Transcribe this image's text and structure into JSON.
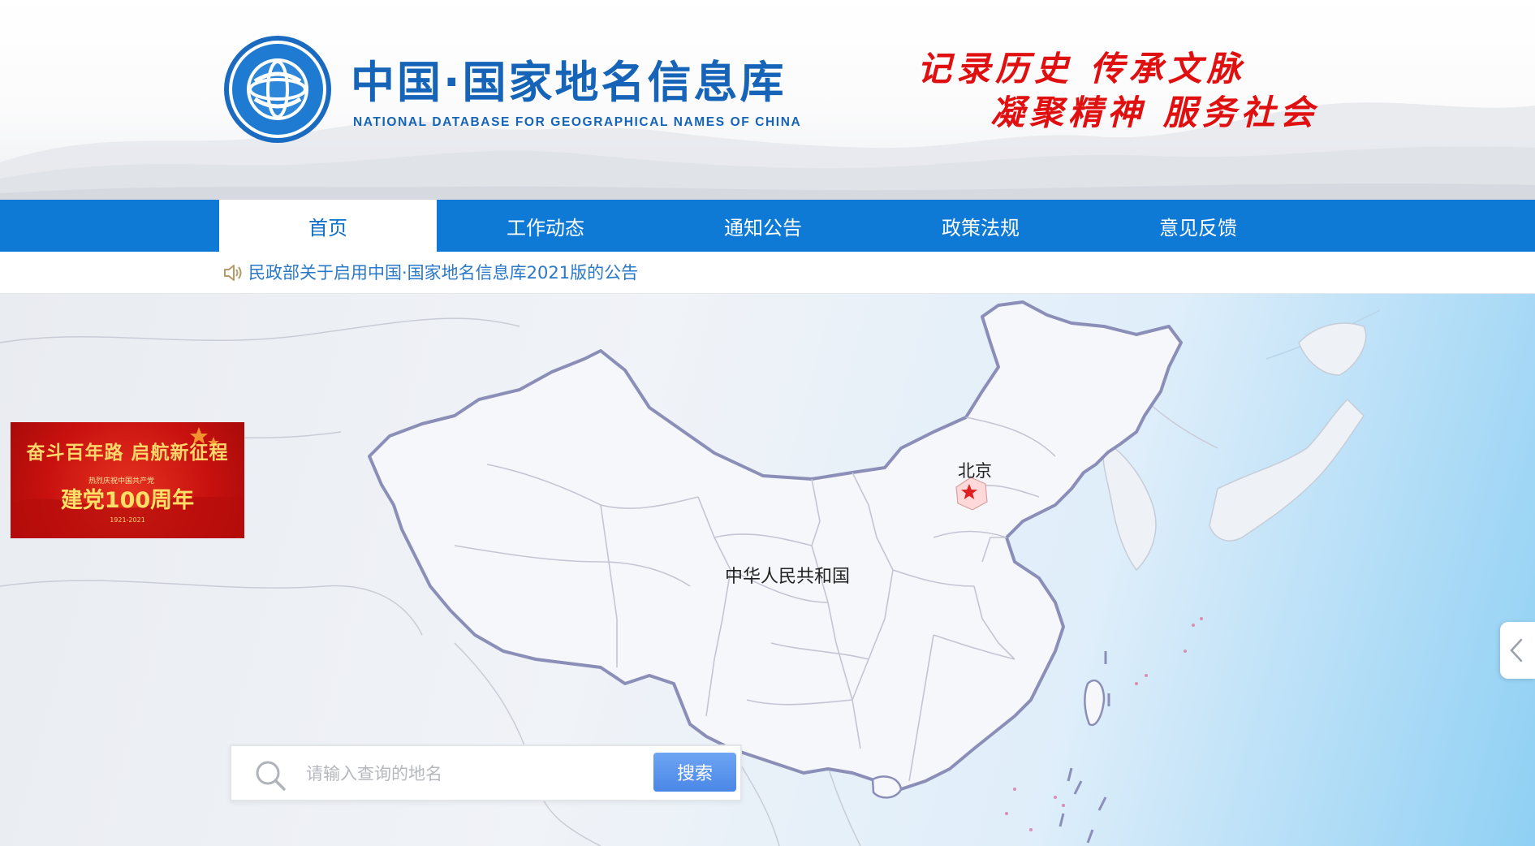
{
  "header": {
    "title": "中国·国家地名信息库",
    "subtitle": "NATIONAL DATABASE FOR GEOGRAPHICAL NAMES OF CHINA",
    "slogan_line1": "记录历史 传承文脉",
    "slogan_line2": "凝聚精神 服务社会",
    "emblem_icon": "globe-emblem-icon",
    "colors": {
      "title": "#1564b8",
      "slogan": "#e01010"
    }
  },
  "nav": {
    "items": [
      {
        "label": "首页",
        "active": true
      },
      {
        "label": "工作动态",
        "active": false
      },
      {
        "label": "通知公告",
        "active": false
      },
      {
        "label": "政策法规",
        "active": false
      },
      {
        "label": "意见反馈",
        "active": false
      }
    ],
    "colors": {
      "bar": "#0e7ad6"
    }
  },
  "notice": {
    "icon": "speaker-icon",
    "text": "民政部关于启用中国·国家地名信息库2021版的公告"
  },
  "banner": {
    "line1": "奋斗百年路 启航新征程",
    "line2": "热烈庆祝中国共产党",
    "line3": "建党100周年",
    "line4": "1921-2021"
  },
  "map": {
    "country_label": "中华人民共和国",
    "capital_label": "北京",
    "capital_icon": "star-icon"
  },
  "search": {
    "placeholder": "请输入查询的地名",
    "button_label": "搜索",
    "icon": "search-icon"
  },
  "side_handle": {
    "icon": "chevron-left-icon"
  }
}
